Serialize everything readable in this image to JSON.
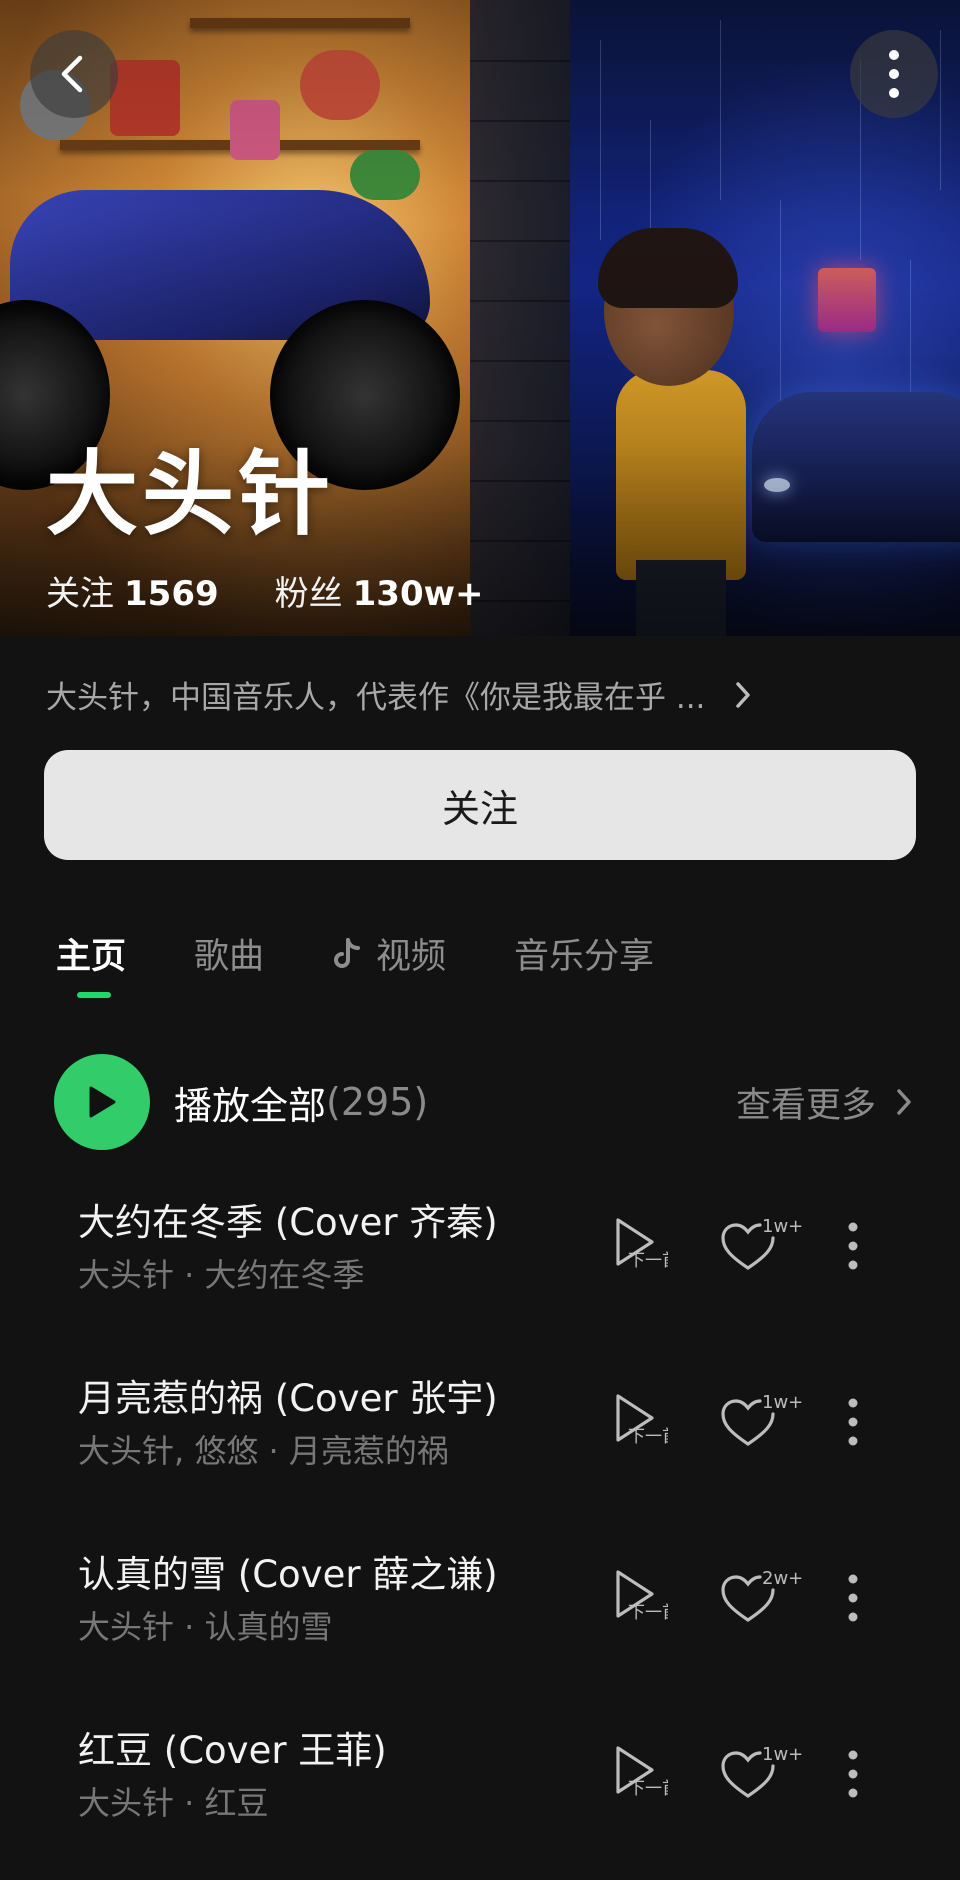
{
  "header": {
    "back_icon": "chevron-left-icon",
    "more_icon": "more-vertical-icon"
  },
  "artist": {
    "name": "大头针",
    "following_label": "关注",
    "following_count": "1569",
    "fans_label": "粉丝",
    "fans_count": "130w+",
    "bio": "大头针，中国音乐人，代表作《你是我最在乎 ..."
  },
  "follow_button": {
    "label": "关注"
  },
  "tabs": [
    {
      "label": "主页",
      "active": true
    },
    {
      "label": "歌曲",
      "active": false
    },
    {
      "label": "视频",
      "active": false,
      "icon": "tiktok-icon"
    },
    {
      "label": "音乐分享",
      "active": false
    }
  ],
  "playlist": {
    "play_all_label": "播放全部",
    "count": "(295)",
    "see_more_label": "查看更多"
  },
  "songs": [
    {
      "title": "大约在冬季 (Cover 齐秦)",
      "subtitle": "大头针 · 大约在冬季",
      "likes": "1w+"
    },
    {
      "title": "月亮惹的祸 (Cover 张宇)",
      "subtitle": "大头针, 悠悠 · 月亮惹的祸",
      "likes": "1w+"
    },
    {
      "title": "认真的雪 (Cover 薛之谦)",
      "subtitle": "大头针 · 认真的雪",
      "likes": "2w+"
    },
    {
      "title": "红豆 (Cover 王菲)",
      "subtitle": "大头针 · 红豆",
      "likes": "1w+"
    }
  ],
  "song_actions": {
    "next_label": "下一首"
  },
  "colors": {
    "accent": "#33cc6a",
    "tab_indicator": "#1ed86a",
    "background": "#121212"
  }
}
